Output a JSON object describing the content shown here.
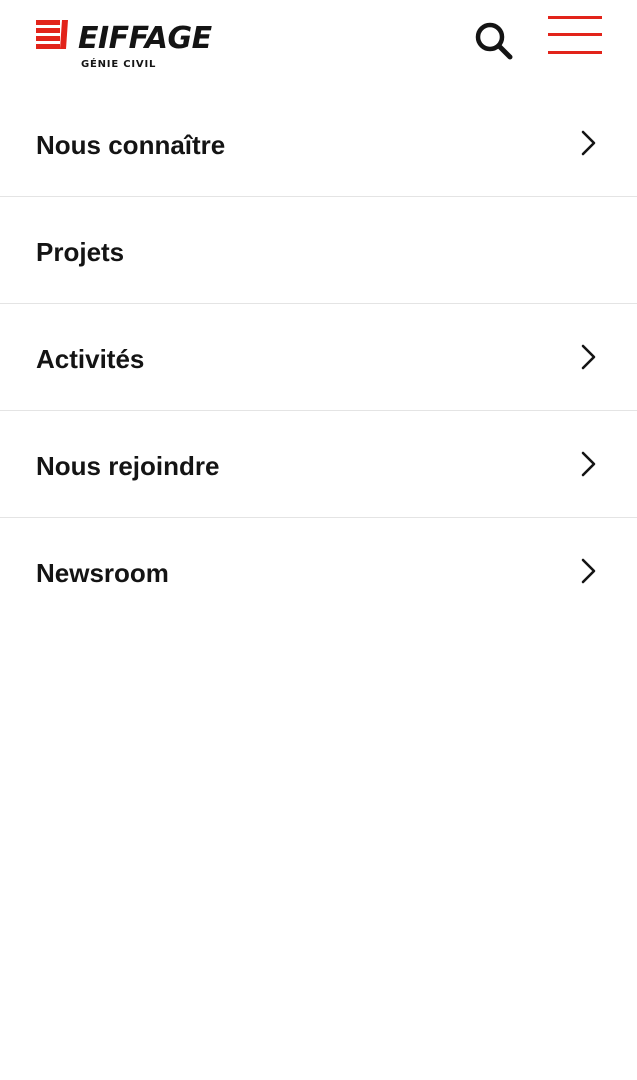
{
  "header": {
    "brand_name": "EIFFAGE",
    "brand_sub": "GÉNIE CIVIL",
    "search_icon": "search-icon",
    "menu_icon": "hamburger-menu-icon",
    "accent_color": "#e2231a"
  },
  "nav": {
    "items": [
      {
        "label": "Nous connaître",
        "has_submenu": true
      },
      {
        "label": "Projets",
        "has_submenu": false
      },
      {
        "label": "Activités",
        "has_submenu": true
      },
      {
        "label": "Nous rejoindre",
        "has_submenu": true
      },
      {
        "label": "Newsroom",
        "has_submenu": true
      }
    ],
    "arrow_icon": "chevron-right-icon"
  }
}
